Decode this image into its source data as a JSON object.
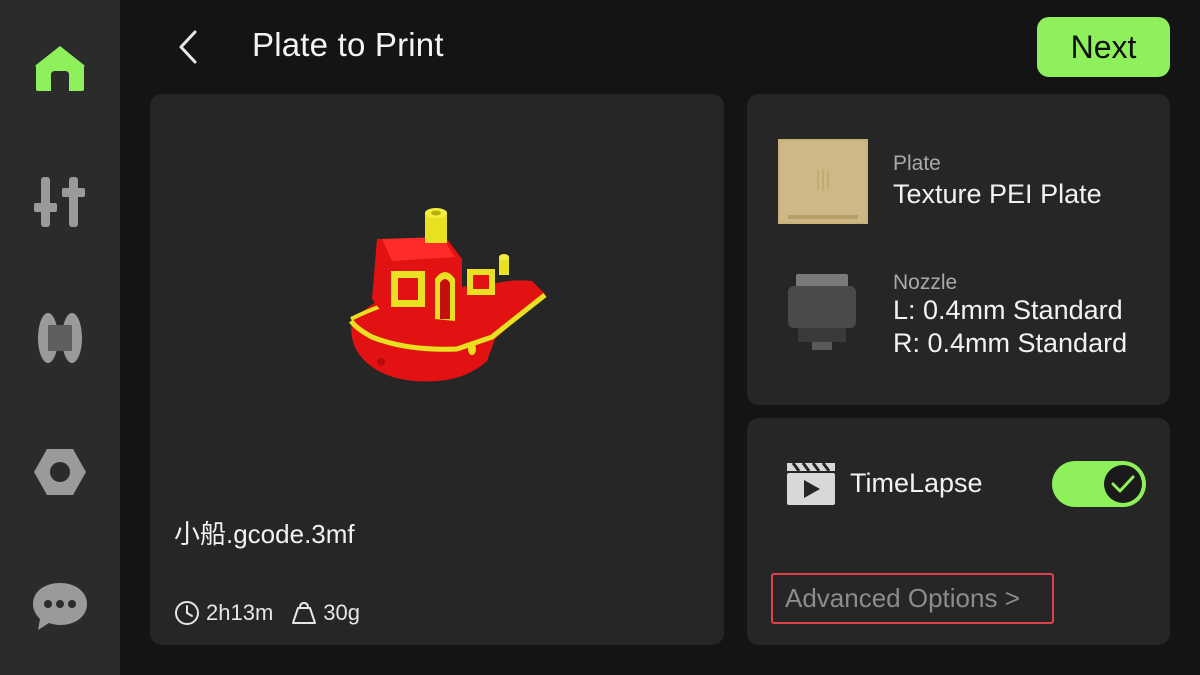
{
  "header": {
    "title": "Plate to Print",
    "next_label": "Next"
  },
  "sidebar": {
    "items": [
      {
        "name": "home",
        "icon": "home-icon",
        "active": true
      },
      {
        "name": "controls",
        "icon": "sliders-icon",
        "active": false
      },
      {
        "name": "filament",
        "icon": "filament-spool-icon",
        "active": false
      },
      {
        "name": "settings",
        "icon": "nut-icon",
        "active": false
      },
      {
        "name": "messages",
        "icon": "chat-bubble-icon",
        "active": false
      }
    ]
  },
  "print_file": {
    "file_name": "小船.gcode.3mf",
    "duration": "2h13m",
    "weight": "30g"
  },
  "plate": {
    "label": "Plate",
    "value": "Texture PEI Plate"
  },
  "nozzle": {
    "label": "Nozzle",
    "left": "L: 0.4mm Standard",
    "right": "R: 0.4mm Standard"
  },
  "timelapse": {
    "label": "TimeLapse",
    "enabled": true
  },
  "advanced_options_label": "Advanced Options >",
  "colors": {
    "accent": "#8ef05a",
    "background": "#141414",
    "card": "#262626",
    "sidebar": "#2b2b2b",
    "highlight_border": "#e0404a"
  }
}
